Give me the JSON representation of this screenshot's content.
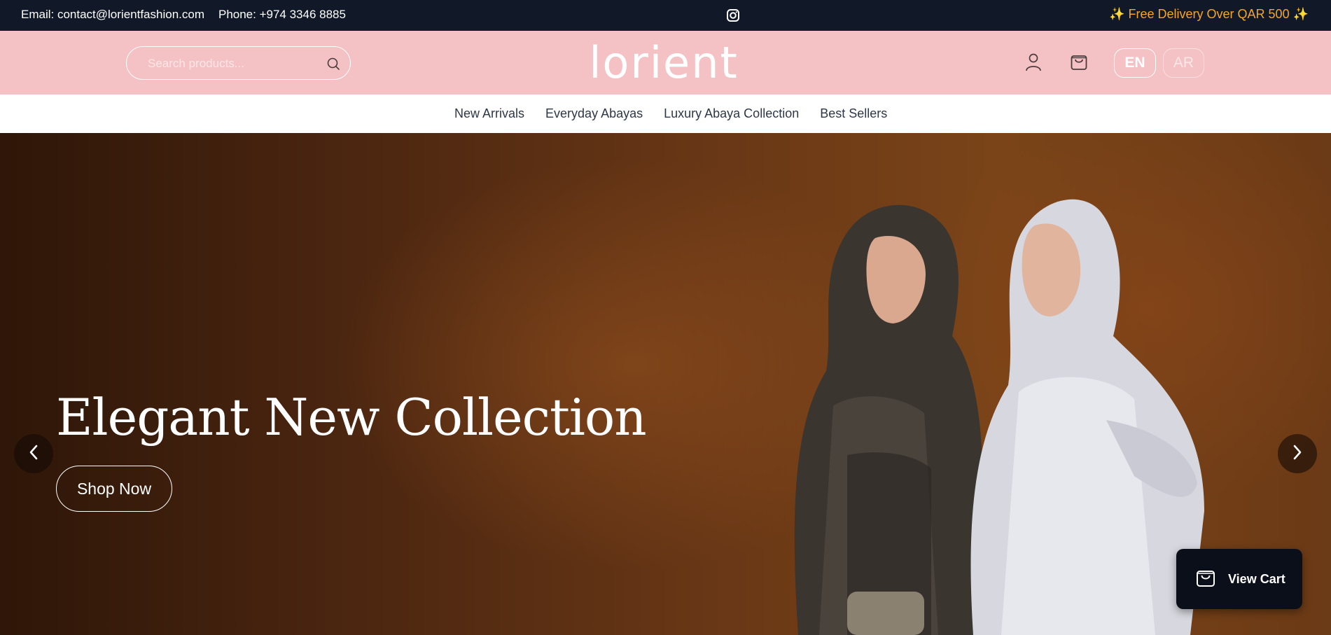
{
  "topbar": {
    "email": "Email: contact@lorientfashion.com",
    "phone": "Phone: +974 3346 8885",
    "promo": "✨ Free Delivery Over QAR 500 ✨",
    "instagram_icon": "instagram-icon"
  },
  "header": {
    "search_placeholder": "Search products...",
    "logo_text": "lorient",
    "lang_en": "EN",
    "lang_ar": "AR",
    "icons": [
      "search-icon",
      "user-icon",
      "shopping-bag-icon"
    ]
  },
  "nav": {
    "items": [
      {
        "label": "New Arrivals"
      },
      {
        "label": "Everyday Abayas"
      },
      {
        "label": "Luxury Abaya Collection"
      },
      {
        "label": "Best Sellers"
      }
    ]
  },
  "hero": {
    "title": "Elegant New Collection",
    "cta": "Shop Now",
    "icons": [
      "chevron-left-icon",
      "chevron-right-icon"
    ]
  },
  "cart_widget": {
    "label": "View Cart",
    "icon": "shopping-bag-icon"
  },
  "colors": {
    "topbar_bg": "#111827",
    "promo": "#f5a623",
    "header_bg": "#f4c2c5",
    "cart_widget_bg": "#0b0f1a"
  }
}
